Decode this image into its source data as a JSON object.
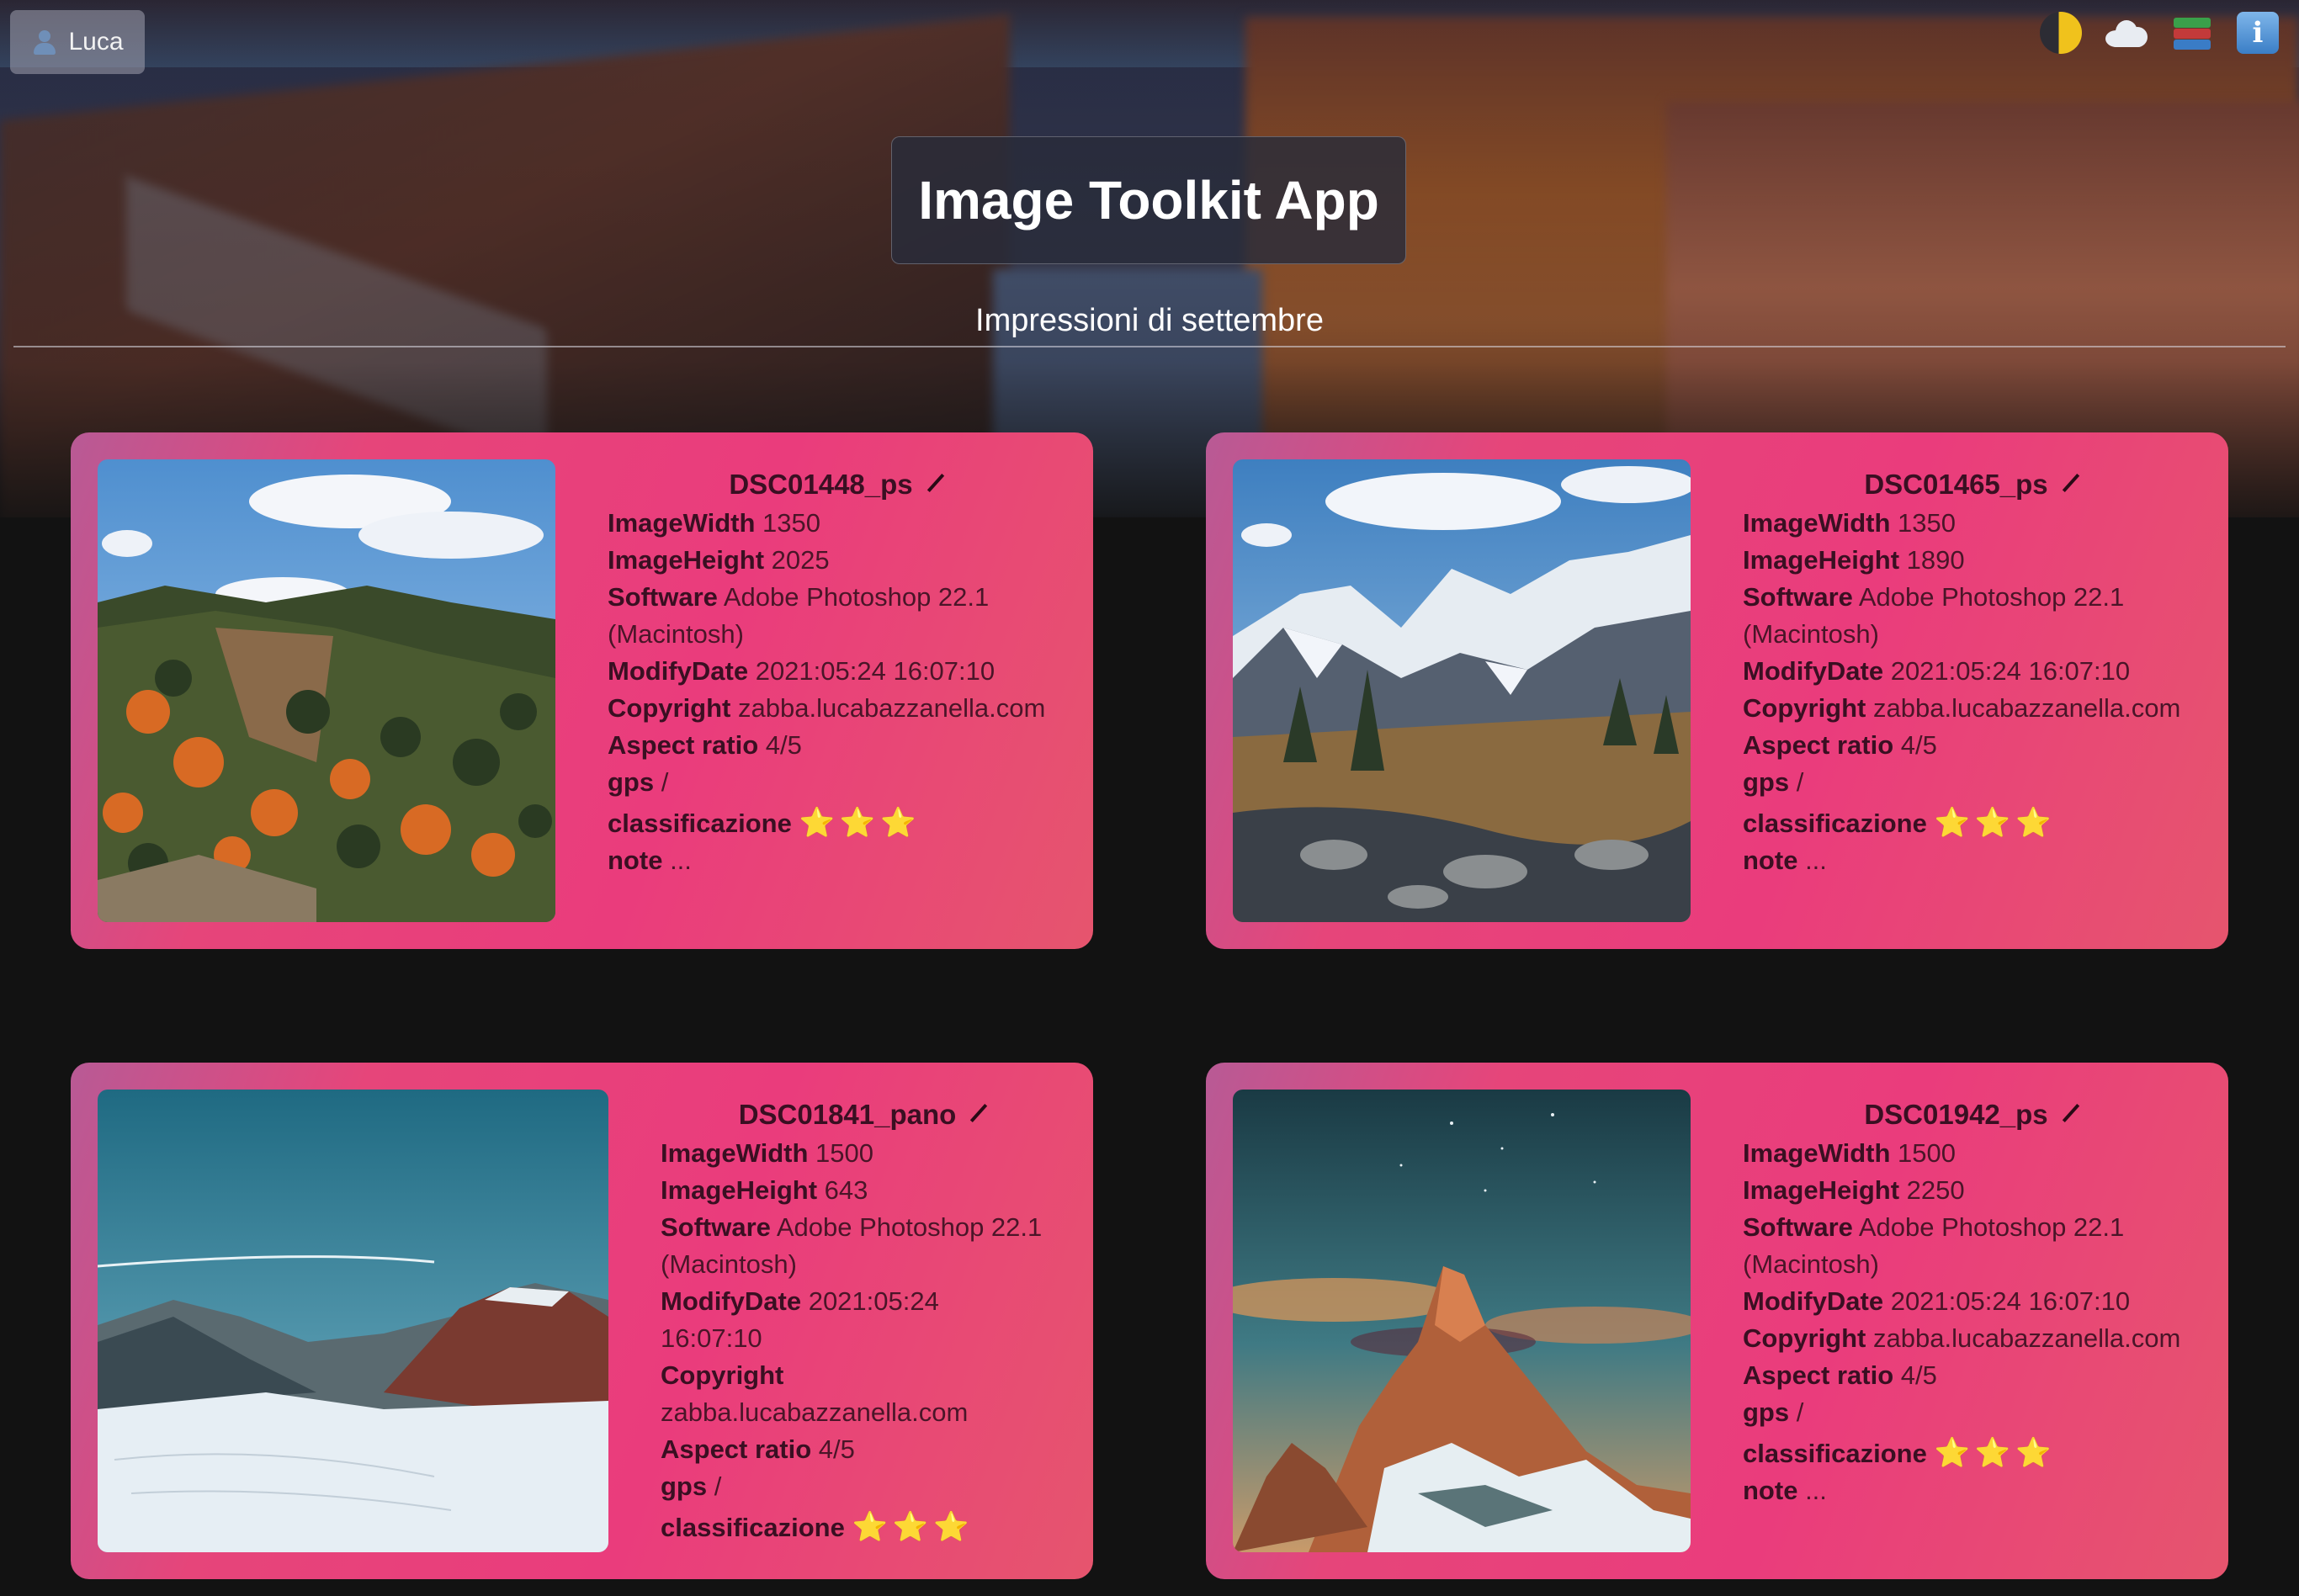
{
  "header": {
    "user_label": "Luca",
    "app_title": "Image Toolkit App",
    "subtitle": "Impressioni di settembre",
    "icons": [
      "theme-toggle-icon",
      "weather-icon",
      "library-icon",
      "info-icon"
    ],
    "info_glyph": "i"
  },
  "cards": [
    {
      "title": "DSC01448_ps",
      "fields": [
        {
          "key": "ImageWidth",
          "value": "1350"
        },
        {
          "key": "ImageHeight",
          "value": "2025"
        },
        {
          "key": "Software",
          "value": "Adobe Photoshop 22.1"
        },
        {
          "key": "",
          "value": "(Macintosh)"
        },
        {
          "key": "ModifyDate",
          "value": "2021:05:24 16:07:10"
        },
        {
          "key": "Copyright",
          "value": "zabba.lucabazzanella.com"
        },
        {
          "key": "Aspect ratio",
          "value": "4/5"
        },
        {
          "key": "gps",
          "value": "/"
        }
      ],
      "rating_label": "classificazione",
      "rating": 3,
      "stars": "⭐⭐⭐",
      "note_label": "note",
      "note": "..."
    },
    {
      "title": "DSC01465_ps",
      "fields": [
        {
          "key": "ImageWidth",
          "value": "1350"
        },
        {
          "key": "ImageHeight",
          "value": "1890"
        },
        {
          "key": "Software",
          "value": "Adobe Photoshop 22.1"
        },
        {
          "key": "",
          "value": "(Macintosh)"
        },
        {
          "key": "ModifyDate",
          "value": "2021:05:24 16:07:10"
        },
        {
          "key": "Copyright",
          "value": "zabba.lucabazzanella.com"
        },
        {
          "key": "Aspect ratio",
          "value": "4/5"
        },
        {
          "key": "gps",
          "value": "/"
        }
      ],
      "rating_label": "classificazione",
      "rating": 3,
      "stars": "⭐⭐⭐",
      "note_label": "note",
      "note": "..."
    },
    {
      "title": "DSC01841_pano",
      "fields": [
        {
          "key": "ImageWidth",
          "value": "1500"
        },
        {
          "key": "ImageHeight",
          "value": "643"
        },
        {
          "key": "Software",
          "value": "Adobe Photoshop 22.1"
        },
        {
          "key": "",
          "value": "(Macintosh)"
        },
        {
          "key": "ModifyDate",
          "value": "2021:05:24"
        },
        {
          "key": "",
          "value": "16:07:10"
        },
        {
          "key": "Copyright",
          "value": ""
        },
        {
          "key": "",
          "value": "zabba.lucabazzanella.com"
        },
        {
          "key": "Aspect ratio",
          "value": "4/5"
        },
        {
          "key": "gps",
          "value": "/"
        }
      ],
      "rating_label": "classificazione",
      "rating": 3,
      "stars": "⭐⭐⭐"
    },
    {
      "title": "DSC01942_ps",
      "fields": [
        {
          "key": "ImageWidth",
          "value": "1500"
        },
        {
          "key": "ImageHeight",
          "value": "2250"
        },
        {
          "key": "Software",
          "value": "Adobe Photoshop 22.1"
        },
        {
          "key": "",
          "value": "(Macintosh)"
        },
        {
          "key": "ModifyDate",
          "value": "2021:05:24 16:07:10"
        },
        {
          "key": "Copyright",
          "value": "zabba.lucabazzanella.com"
        },
        {
          "key": "Aspect ratio",
          "value": "4/5"
        },
        {
          "key": "gps",
          "value": "/"
        }
      ],
      "rating_label": "classificazione",
      "rating": 3,
      "stars": "⭐⭐⭐",
      "note_label": "note",
      "note": "..."
    }
  ]
}
